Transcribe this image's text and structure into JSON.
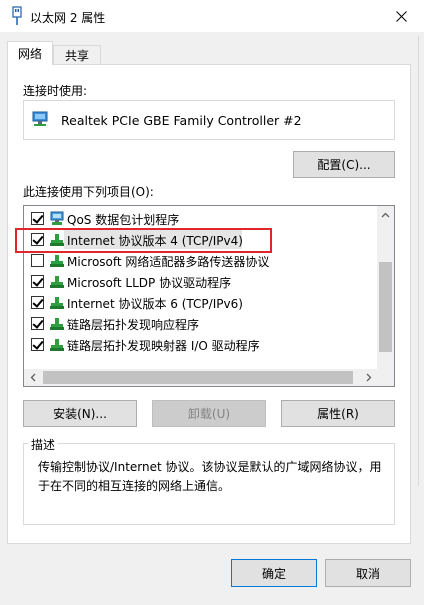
{
  "window": {
    "title": "以太网 2 属性"
  },
  "tabs": [
    {
      "label": "网络",
      "active": true
    },
    {
      "label": "共享",
      "active": false
    }
  ],
  "connect_using": {
    "label": "连接时使用:",
    "adapter_name": "Realtek PCIe GBE Family Controller #2",
    "configure_button": "配置(C)..."
  },
  "components": {
    "label": "此连接使用下列项目(O):",
    "items": [
      {
        "text": "QoS 数据包计划程序",
        "checked": true,
        "icon": "qos-scheduler-icon"
      },
      {
        "text": "Internet 协议版本 4 (TCP/IPv4)",
        "checked": true,
        "icon": "network-protocol-icon"
      },
      {
        "text": "Microsoft 网络适配器多路传送器协议",
        "checked": false,
        "icon": "network-protocol-icon"
      },
      {
        "text": "Microsoft LLDP 协议驱动程序",
        "checked": true,
        "icon": "network-protocol-icon"
      },
      {
        "text": "Internet 协议版本 6 (TCP/IPv6)",
        "checked": true,
        "icon": "network-protocol-icon"
      },
      {
        "text": "链路层拓扑发现响应程序",
        "checked": true,
        "icon": "network-protocol-icon"
      },
      {
        "text": "链路层拓扑发现映射器 I/O 驱动程序",
        "checked": true,
        "icon": "network-protocol-icon"
      }
    ]
  },
  "actions": {
    "install": "安装(N)...",
    "uninstall": "卸载(U)",
    "properties": "属性(R)"
  },
  "description": {
    "title": "描述",
    "text": "传输控制协议/Internet 协议。该协议是默认的广域网络协议，用于在不同的相互连接的网络上通信。"
  },
  "footer": {
    "ok": "确定",
    "cancel": "取消"
  },
  "colors": {
    "highlight_border": "#e0262b",
    "default_button_border": "#0078d7"
  }
}
